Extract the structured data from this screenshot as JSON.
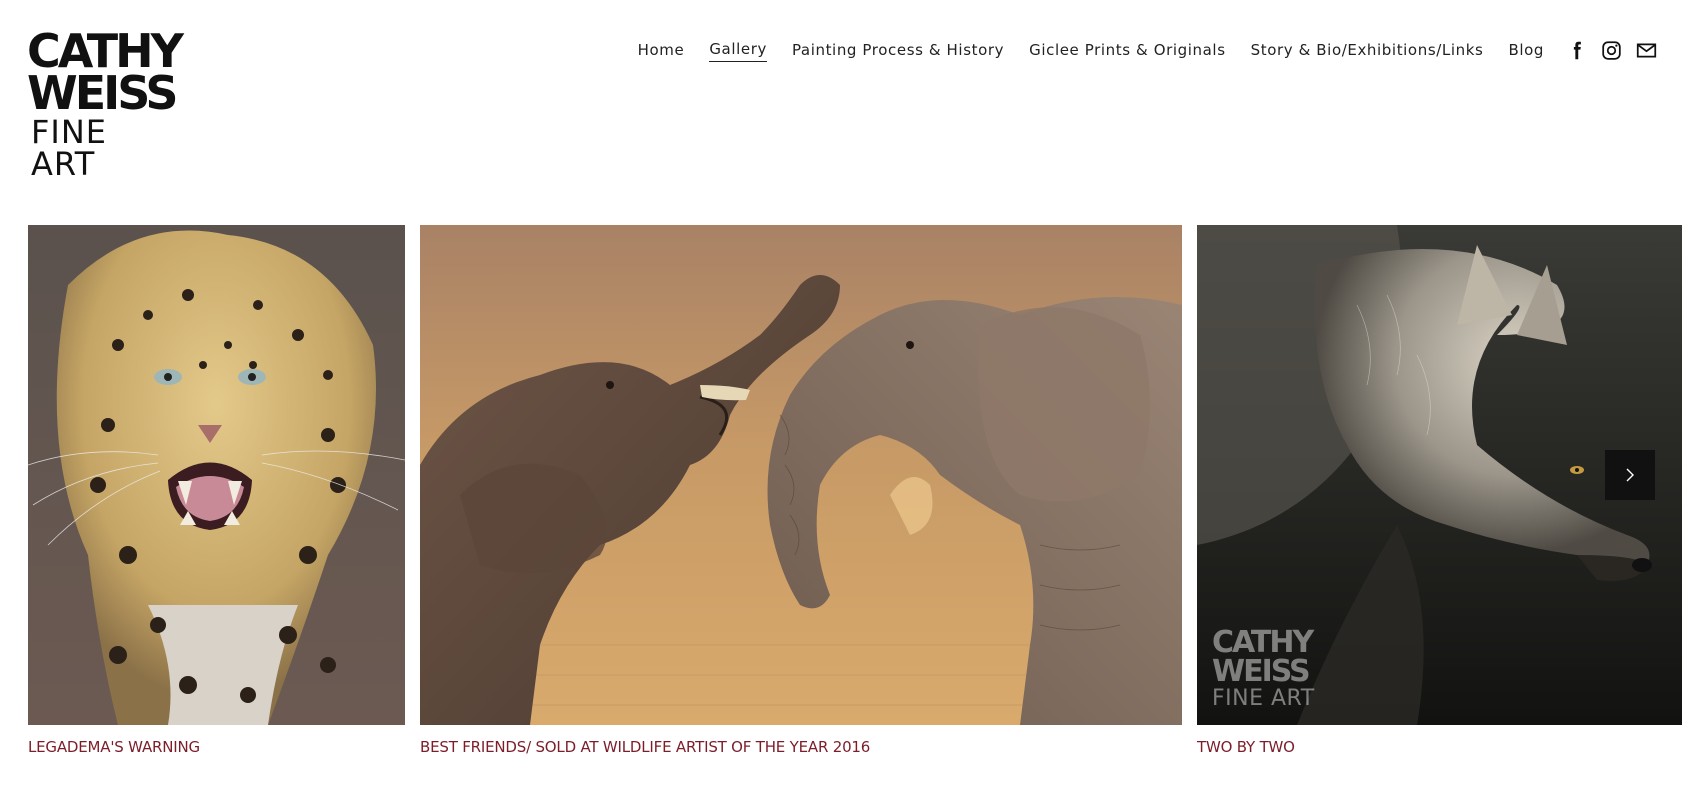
{
  "brand": {
    "line1": "CATHY",
    "line2": "WEISS",
    "line3": "FINE ART"
  },
  "nav": {
    "items": [
      {
        "label": "Home"
      },
      {
        "label": "Gallery"
      },
      {
        "label": "Painting Process & History"
      },
      {
        "label": "Giclee Prints & Originals"
      },
      {
        "label": "Story & Bio/Exhibitions/Links"
      },
      {
        "label": "Blog"
      }
    ],
    "active": "Gallery"
  },
  "social": {
    "icons": [
      "facebook-icon",
      "instagram-icon",
      "email-icon"
    ]
  },
  "gallery": {
    "slides": [
      {
        "caption": "LEGADEMA'S WARNING"
      },
      {
        "caption": "BEST FRIENDS/ SOLD AT WILDLIFE ARTIST OF THE YEAR 2016"
      },
      {
        "caption": "TWO BY TWO",
        "watermark": {
          "line1": "CATHY",
          "line2": "WEISS",
          "line3": "FINE ART"
        }
      }
    ],
    "next_icon": "chevron-right-icon"
  },
  "colors": {
    "caption": "#7c1d2a",
    "text": "#222222",
    "next_button": "#111111"
  }
}
